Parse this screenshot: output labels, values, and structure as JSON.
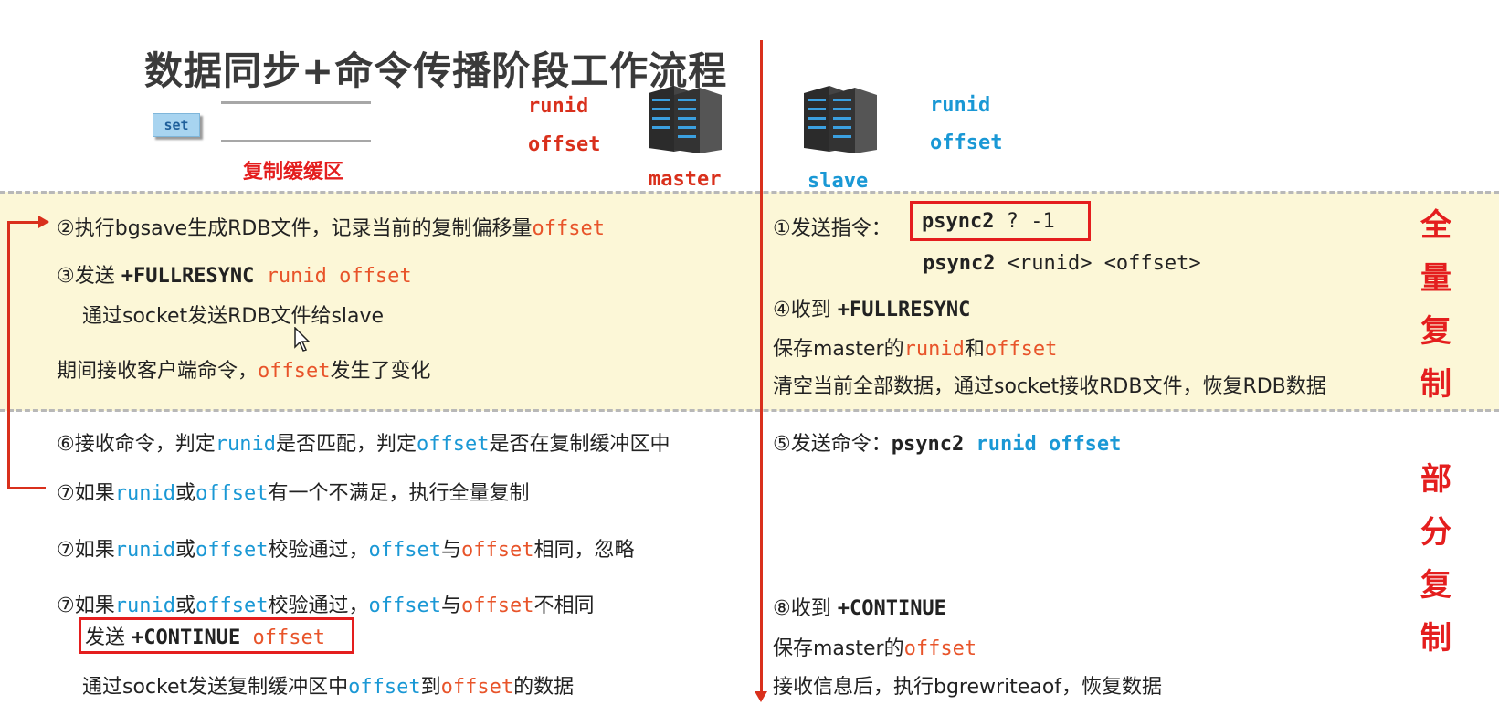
{
  "title": "数据同步+命令传播阶段工作流程",
  "header": {
    "set_label": "set",
    "buffer_label": "复制缓缓区",
    "master": {
      "runid": "runid",
      "offset": "offset",
      "name": "master"
    },
    "slave": {
      "runid": "runid",
      "offset": "offset",
      "name": "slave"
    }
  },
  "sections": {
    "full": [
      "全",
      "量",
      "复",
      "制"
    ],
    "partial": [
      "部",
      "分",
      "复",
      "制"
    ]
  },
  "left": {
    "s2": {
      "prefix": "②执行bgsave生成RDB文件，记录当前的复制偏移量",
      "offset": "offset"
    },
    "s3": {
      "prefix": "③发送 ",
      "cmd": "+FULLRESYNC",
      "runid": " runid",
      "offset": " offset"
    },
    "s3b": "通过socket发送RDB文件给slave",
    "during": {
      "prefix": "期间接收客户端命令，",
      "offset": "offset",
      "suffix": "发生了变化"
    },
    "s6": {
      "a": "⑥接收命令，判定",
      "runid": "runid",
      "b": "是否匹配，判定",
      "offset": "offset",
      "c": "是否在复制缓冲区中"
    },
    "s7a": {
      "a": "⑦如果",
      "runid": "runid",
      "b": "或",
      "offset": "offset",
      "c": "有一个不满足，执行全量复制"
    },
    "s7b": {
      "a": "⑦如果",
      "runid": "runid",
      "b": "或",
      "offset": "offset",
      "c": "校验通过，",
      "offset2": "offset",
      "d": "与",
      "offset3": "offset",
      "e": "相同，忽略"
    },
    "s7c": {
      "a": "⑦如果",
      "runid": "runid",
      "b": "或",
      "offset": "offset",
      "c": "校验通过，",
      "offset2": "offset",
      "d": "与",
      "offset3": "offset",
      "e": "不相同"
    },
    "send_continue": {
      "a": "发送 ",
      "cmd": "+CONTINUE",
      "offset": " offset"
    },
    "last": {
      "a": "通过socket发送复制缓冲区中",
      "offset": "offset",
      "b": "到",
      "offset2": "offset",
      "c": "的数据"
    }
  },
  "right": {
    "s1": {
      "prefix": "①发送指令：",
      "cmd": "psync2",
      "args": "  ? -1"
    },
    "s1b": {
      "cmd": "psync2",
      "args": "  <runid> <offset>"
    },
    "s4": {
      "prefix": "④收到 ",
      "cmd": "+FULLRESYNC"
    },
    "save": {
      "a": "保存master的",
      "runid": "runid",
      "b": "和",
      "offset": "offset"
    },
    "clear": "清空当前全部数据，通过socket接收RDB文件，恢复RDB数据",
    "s5": {
      "prefix": "⑤发送命令：",
      "cmd": "psync2",
      "runid": "  runid",
      "offset": " offset"
    },
    "s8": {
      "prefix": "⑧收到 ",
      "cmd": "+CONTINUE"
    },
    "save2": {
      "a": "保存master的",
      "offset": "offset"
    },
    "recv": "接收信息后，执行bgrewriteaof，恢复数据"
  },
  "colors": {
    "accent_red": "#e41e1e",
    "blue": "#1a98d5",
    "orange": "#e8542a",
    "band": "#fcf7d7"
  }
}
